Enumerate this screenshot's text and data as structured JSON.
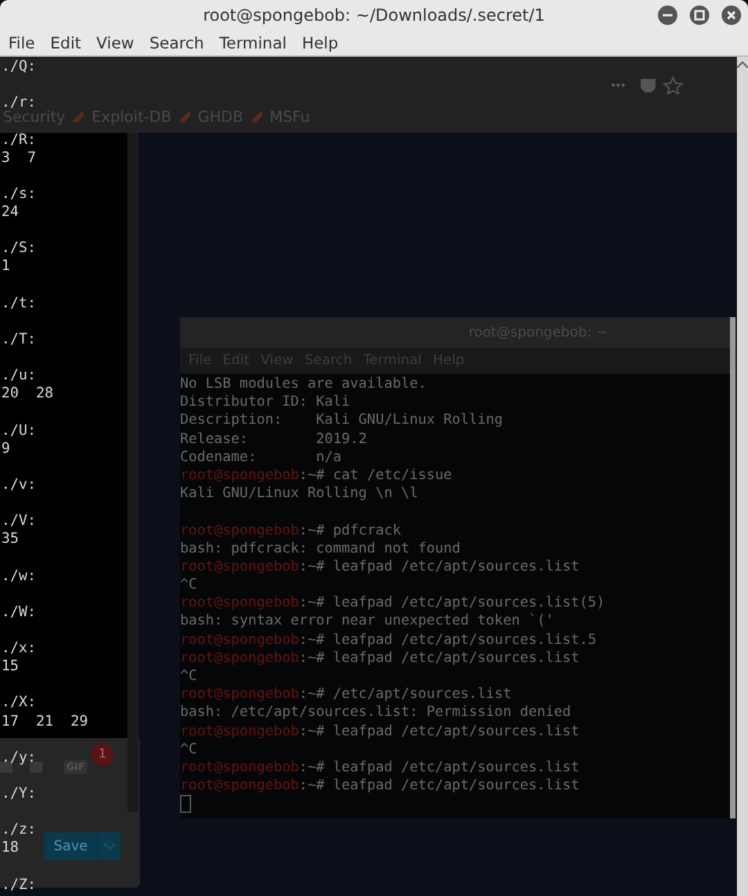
{
  "window": {
    "title": "root@spongebob: ~/Downloads/.secret/1"
  },
  "menu": [
    "File",
    "Edit",
    "View",
    "Search",
    "Terminal",
    "Help"
  ],
  "terminal": {
    "lines": [
      {
        "kind": "text",
        "text": "./Q:"
      },
      {
        "kind": "blank"
      },
      {
        "kind": "text",
        "text": "./r:"
      },
      {
        "kind": "blank"
      },
      {
        "kind": "text",
        "text": "./R:"
      },
      {
        "kind": "text",
        "text": "3  7"
      },
      {
        "kind": "blank"
      },
      {
        "kind": "text",
        "text": "./s:"
      },
      {
        "kind": "text",
        "text": "24"
      },
      {
        "kind": "blank"
      },
      {
        "kind": "text",
        "text": "./S:"
      },
      {
        "kind": "text",
        "text": "1"
      },
      {
        "kind": "blank"
      },
      {
        "kind": "text",
        "text": "./t:"
      },
      {
        "kind": "blank"
      },
      {
        "kind": "text",
        "text": "./T:"
      },
      {
        "kind": "blank"
      },
      {
        "kind": "text",
        "text": "./u:"
      },
      {
        "kind": "text",
        "text": "20  28"
      },
      {
        "kind": "blank"
      },
      {
        "kind": "text",
        "text": "./U:"
      },
      {
        "kind": "text",
        "text": "9"
      },
      {
        "kind": "blank"
      },
      {
        "kind": "text",
        "text": "./v:"
      },
      {
        "kind": "blank"
      },
      {
        "kind": "text",
        "text": "./V:"
      },
      {
        "kind": "text",
        "text": "35"
      },
      {
        "kind": "blank"
      },
      {
        "kind": "text",
        "text": "./w:"
      },
      {
        "kind": "blank"
      },
      {
        "kind": "text",
        "text": "./W:"
      },
      {
        "kind": "blank"
      },
      {
        "kind": "text",
        "text": "./x:"
      },
      {
        "kind": "text",
        "text": "15"
      },
      {
        "kind": "blank"
      },
      {
        "kind": "text",
        "text": "./X:"
      },
      {
        "kind": "text",
        "text": "17  21  29"
      },
      {
        "kind": "blank"
      },
      {
        "kind": "text",
        "text": "./y:"
      },
      {
        "kind": "blank"
      },
      {
        "kind": "text",
        "text": "./Y:"
      },
      {
        "kind": "blank"
      },
      {
        "kind": "text",
        "text": "./z:"
      },
      {
        "kind": "text",
        "text": "18"
      },
      {
        "kind": "blank"
      },
      {
        "kind": "text",
        "text": "./Z:"
      }
    ]
  },
  "background_browser": {
    "bookmarks": [
      "Security",
      "Exploit-DB",
      "GHDB",
      "MSFu"
    ]
  },
  "background_panel": {
    "badge": "1",
    "gif_label": "GIF",
    "save_label": "Save"
  },
  "inner_terminal": {
    "title": "root@spongebob: ~",
    "menu": [
      "File",
      "Edit",
      "View",
      "Search",
      "Terminal",
      "Help"
    ],
    "lines": [
      {
        "kind": "output",
        "text": "No LSB modules are available."
      },
      {
        "kind": "output",
        "text": "Distributor ID: Kali"
      },
      {
        "kind": "output",
        "text": "Description:    Kali GNU/Linux Rolling"
      },
      {
        "kind": "output",
        "text": "Release:        2019.2"
      },
      {
        "kind": "output",
        "text": "Codename:       n/a"
      },
      {
        "kind": "prompt",
        "user": "root@spongebob",
        "text": ":~# cat /etc/issue"
      },
      {
        "kind": "output",
        "text": "Kali GNU/Linux Rolling \\n \\l"
      },
      {
        "kind": "blank"
      },
      {
        "kind": "prompt",
        "user": "root@spongebob",
        "text": ":~# pdfcrack"
      },
      {
        "kind": "output",
        "text": "bash: pdfcrack: command not found"
      },
      {
        "kind": "prompt",
        "user": "root@spongebob",
        "text": ":~# leafpad /etc/apt/sources.list"
      },
      {
        "kind": "output",
        "text": "^C"
      },
      {
        "kind": "prompt",
        "user": "root@spongebob",
        "text": ":~# leafpad /etc/apt/sources.list(5)"
      },
      {
        "kind": "output",
        "text": "bash: syntax error near unexpected token `('"
      },
      {
        "kind": "prompt",
        "user": "root@spongebob",
        "text": ":~# leafpad /etc/apt/sources.list.5"
      },
      {
        "kind": "prompt",
        "user": "root@spongebob",
        "text": ":~# leafpad /etc/apt/sources.list"
      },
      {
        "kind": "output",
        "text": "^C"
      },
      {
        "kind": "prompt",
        "user": "root@spongebob",
        "text": ":~# /etc/apt/sources.list"
      },
      {
        "kind": "output",
        "text": "bash: /etc/apt/sources.list: Permission denied"
      },
      {
        "kind": "prompt",
        "user": "root@spongebob",
        "text": ":~# leafpad /etc/apt/sources.list"
      },
      {
        "kind": "output",
        "text": "^C"
      },
      {
        "kind": "prompt",
        "user": "root@spongebob",
        "text": ":~# leafpad /etc/apt/sources.list"
      },
      {
        "kind": "prompt",
        "user": "root@spongebob",
        "text": ":~# leafpad /etc/apt/sources.list"
      },
      {
        "kind": "cursor"
      }
    ]
  }
}
